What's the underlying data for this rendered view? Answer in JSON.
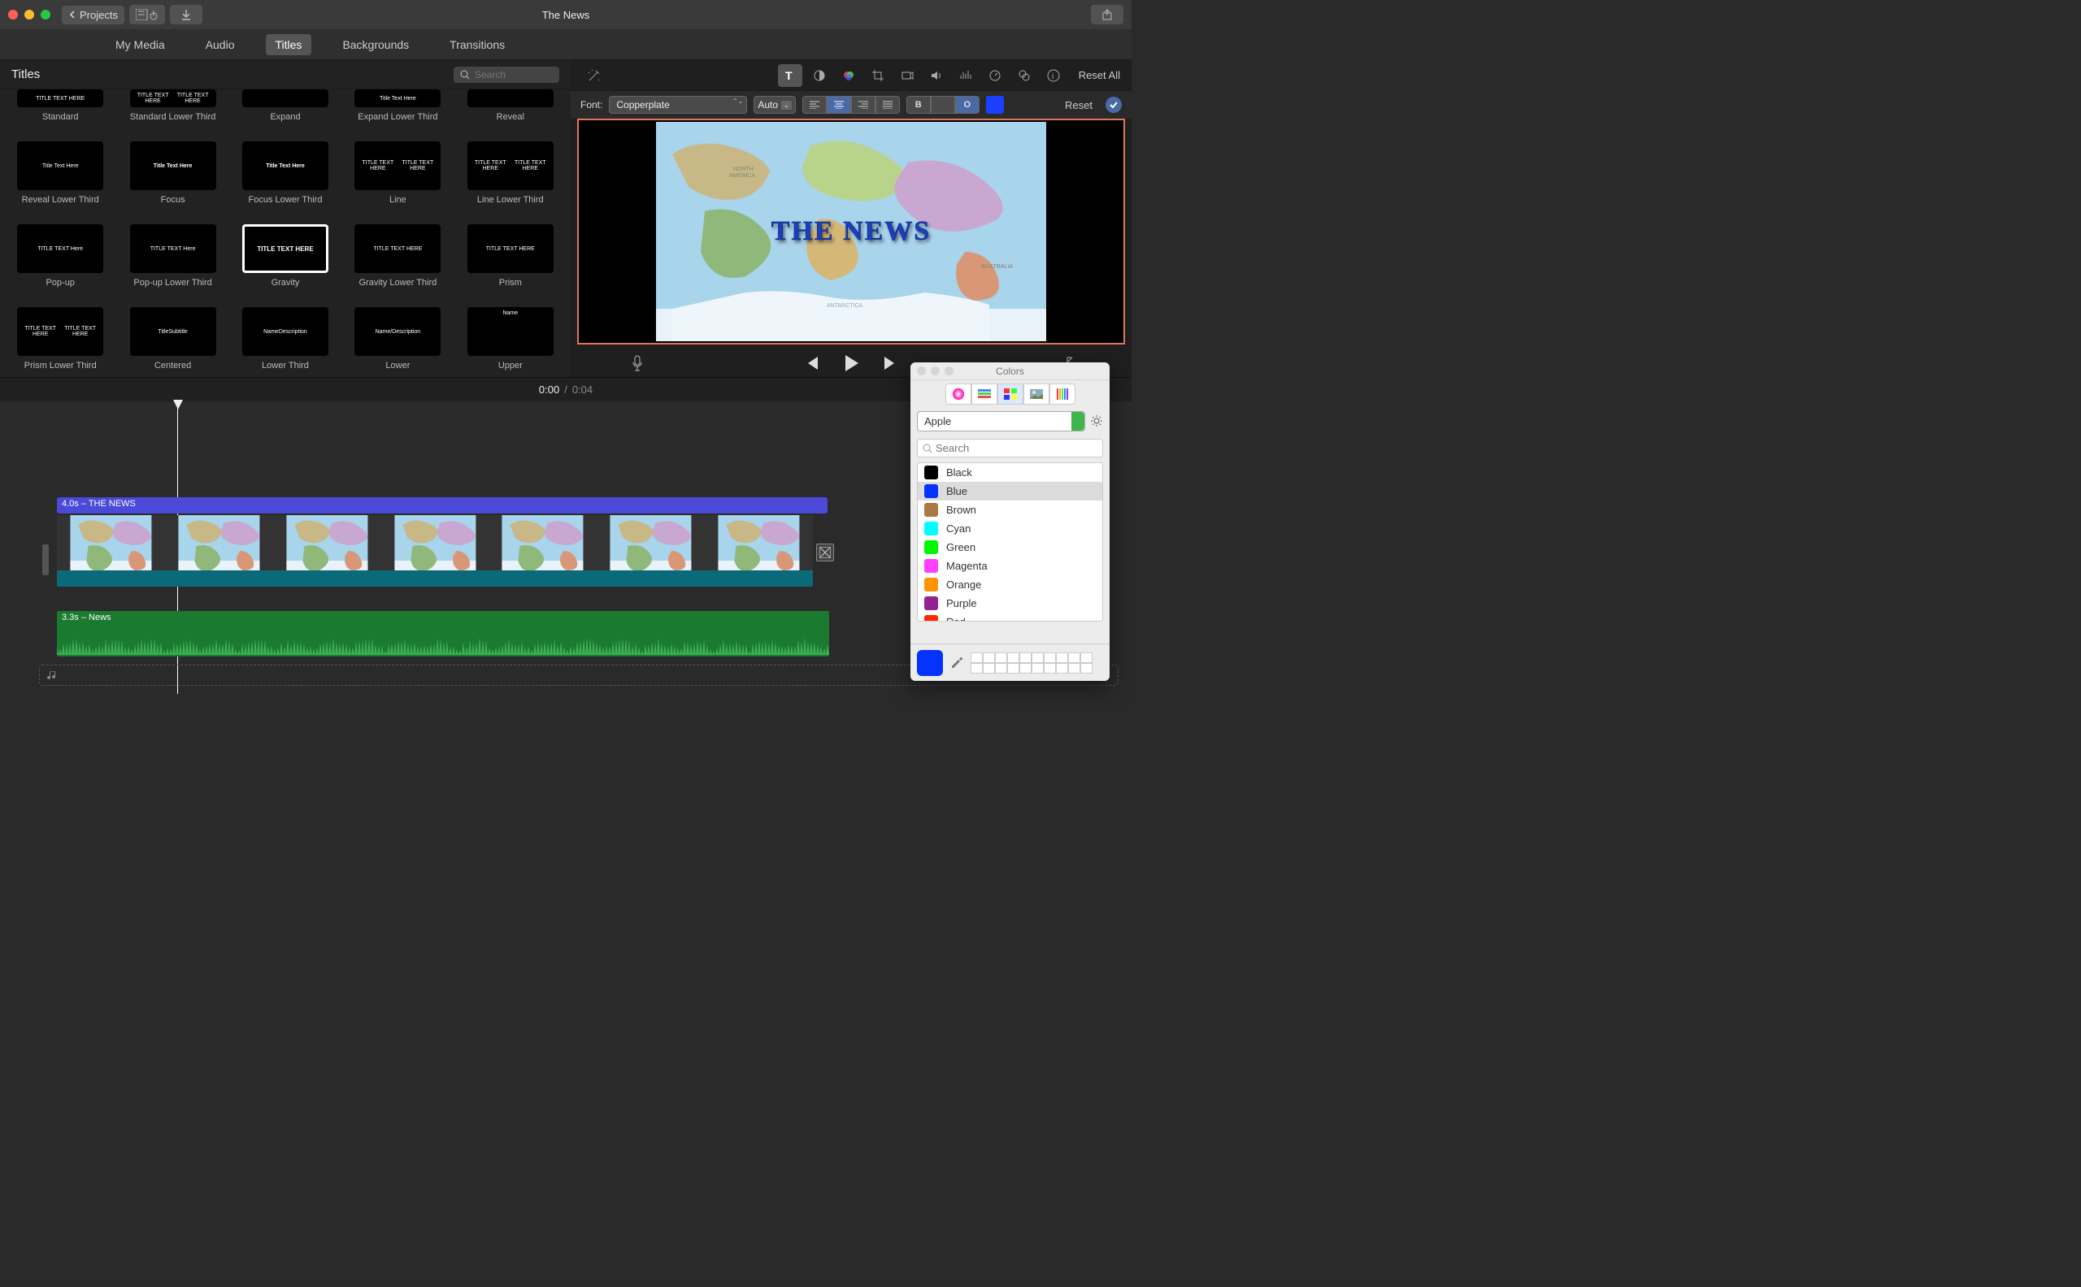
{
  "window": {
    "title": "The News",
    "back_label": "Projects"
  },
  "tabs": [
    "My Media",
    "Audio",
    "Titles",
    "Backgrounds",
    "Transitions"
  ],
  "active_tab": 2,
  "browser": {
    "title": "Titles",
    "search_placeholder": "Search"
  },
  "titles_grid": [
    [
      "Standard",
      "Standard Lower Third",
      "Expand",
      "Expand Lower Third",
      "Reveal"
    ],
    [
      "Reveal Lower Third",
      "Focus",
      "Focus Lower Third",
      "Line",
      "Line Lower Third"
    ],
    [
      "Pop-up",
      "Pop-up Lower Third",
      "Gravity",
      "Gravity Lower Third",
      "Prism"
    ],
    [
      "Prism Lower Third",
      "Centered",
      "Lower Third",
      "Lower",
      "Upper"
    ]
  ],
  "selected_tile": "Gravity",
  "thumb_text": {
    "Standard": "TITLE TEXT HERE",
    "Standard Lower Third": "TITLE TEXT HERE\nTITLE TEXT HERE",
    "Expand": "",
    "Expand Lower Third": "Title Text Here",
    "Reveal": "",
    "Reveal Lower Third": "Title Text Here",
    "Focus": "Title Text Here",
    "Focus Lower Third": "Title Text Here",
    "Line": "TITLE TEXT HERE\nTITLE TEXT HERE",
    "Line Lower Third": "TITLE TEXT HERE\nTITLE TEXT HERE",
    "Pop-up": "TITLE TEXT Here",
    "Pop-up Lower Third": "TITLE TEXT Here",
    "Gravity": "TITLE TEXT HERE",
    "Gravity Lower Third": "TITLE TEXT HERE",
    "Prism": "TITLE TEXT HERE",
    "Prism Lower Third": "TITLE TEXT HERE\nTITLE TEXT HERE",
    "Centered": "Title\nSubtitle",
    "Lower Third": "Name\nDescription",
    "Lower": "Name/Description",
    "Upper": "Name"
  },
  "inspector": {
    "tools": [
      "text",
      "color-balance",
      "color-wheel",
      "crop",
      "stabilize",
      "volume",
      "eq",
      "speed",
      "fx",
      "info"
    ],
    "active_tool": 0,
    "reset_all": "Reset All"
  },
  "fontbar": {
    "label": "Font:",
    "font": "Copperplate",
    "size": "Auto",
    "style_bold": "B",
    "style_outline": "O",
    "color": "#1b3fff",
    "reset": "Reset"
  },
  "preview": {
    "headline": "THE NEWS"
  },
  "timecode": {
    "current": "0:00",
    "duration": "0:04"
  },
  "timeline": {
    "title_clip": "4.0s – THE NEWS",
    "audio_clip": "3.3s – News"
  },
  "colors": {
    "title": "Colors",
    "palette": "Apple",
    "search_placeholder": "Search",
    "list": [
      {
        "name": "Black",
        "hex": "#000000"
      },
      {
        "name": "Blue",
        "hex": "#0433ff"
      },
      {
        "name": "Brown",
        "hex": "#aa7942"
      },
      {
        "name": "Cyan",
        "hex": "#00fdff"
      },
      {
        "name": "Green",
        "hex": "#00f900"
      },
      {
        "name": "Magenta",
        "hex": "#ff40ff"
      },
      {
        "name": "Orange",
        "hex": "#ff9300"
      },
      {
        "name": "Purple",
        "hex": "#942192"
      },
      {
        "name": "Red",
        "hex": "#ff2600"
      }
    ],
    "selected": "Blue",
    "current": "#0433ff"
  }
}
